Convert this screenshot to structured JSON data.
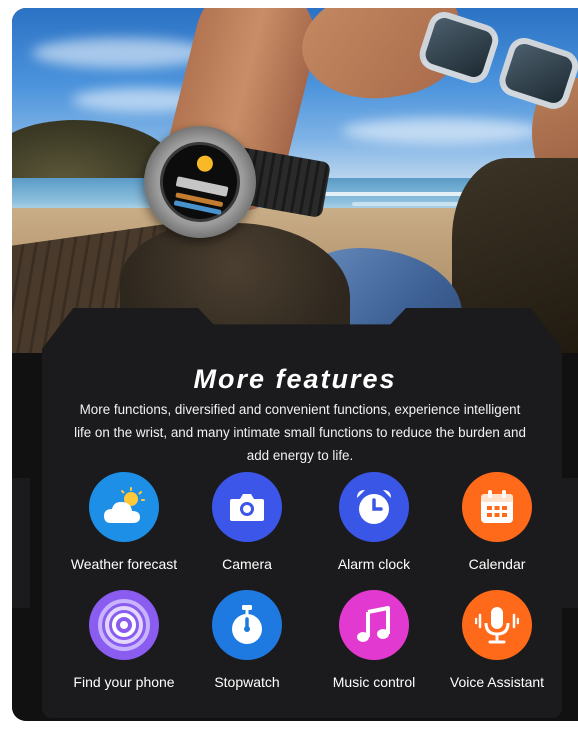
{
  "panel": {
    "title": "More features",
    "description": "More functions, diversified and convenient functions, experience intelligent life on the wrist, and many intimate small functions to reduce the burden and add energy to life."
  },
  "features": [
    {
      "label": "Weather forecast",
      "icon": "weather-icon",
      "color": "#1e8fe6"
    },
    {
      "label": "Camera",
      "icon": "camera-icon",
      "color": "#3b56e8"
    },
    {
      "label": "Alarm clock",
      "icon": "alarm-clock-icon",
      "color": "#3a56e6"
    },
    {
      "label": "Calendar",
      "icon": "calendar-icon",
      "color": "#ff6a1a"
    },
    {
      "label": "Find your phone",
      "icon": "find-phone-icon",
      "color": "#8a5cf0"
    },
    {
      "label": "Stopwatch",
      "icon": "stopwatch-icon",
      "color": "#1e7ae0"
    },
    {
      "label": "Music control",
      "icon": "music-icon",
      "color": "#e23ad0"
    },
    {
      "label": "Voice Assistant",
      "icon": "microphone-icon",
      "color": "#ff6a1a"
    }
  ]
}
